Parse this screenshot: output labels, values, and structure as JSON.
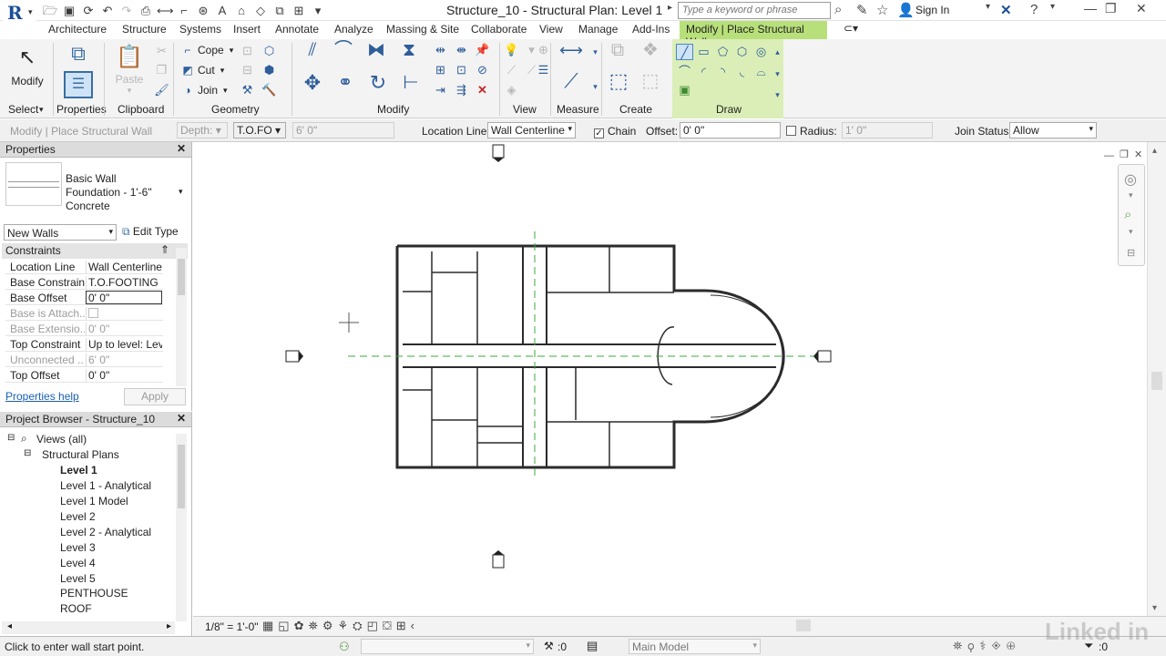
{
  "window": {
    "title": "Structure_10 - Structural Plan: Level 1",
    "search_placeholder": "Type a keyword or phrase",
    "signin": "Sign In"
  },
  "tabs": [
    "Architecture",
    "Structure",
    "Systems",
    "Insert",
    "Annotate",
    "Analyze",
    "Massing & Site",
    "Collaborate",
    "View",
    "Manage",
    "Add-Ins"
  ],
  "context_tab": "Modify | Place Structural Wall",
  "ribbon": {
    "modify": "Modify",
    "properties": "Properties",
    "paste": "Paste",
    "cope": "Cope",
    "cut": "Cut",
    "join": "Join",
    "panels": {
      "select": "Select",
      "properties": "Properties",
      "clipboard": "Clipboard",
      "geometry": "Geometry",
      "modify": "Modify",
      "view": "View",
      "measure": "Measure",
      "create": "Create",
      "draw": "Draw"
    }
  },
  "options": {
    "context": "Modify | Place Structural Wall",
    "depth_label": "Depth:",
    "depth_level": "T.O.FO",
    "depth_value": "6'  0\"",
    "location_line_label": "Location Line:",
    "location_line": "Wall Centerline",
    "chain_label": "Chain",
    "offset_label": "Offset:",
    "offset_value": "0'  0\"",
    "radius_label": "Radius:",
    "radius_value": "1'  0\"",
    "join_status_label": "Join Status:",
    "join_status": "Allow"
  },
  "properties": {
    "title": "Properties",
    "type_line1": "Basic Wall",
    "type_line2": "Foundation - 1'-6\"",
    "type_line3": "Concrete",
    "filter": "New Walls",
    "edit_type": "Edit Type",
    "section": "Constraints",
    "rows": [
      {
        "k": "Location Line",
        "v": "Wall Centerline"
      },
      {
        "k": "Base Constraint",
        "v": "T.O.FOOTING"
      },
      {
        "k": "Base Offset",
        "v": "0'  0\""
      },
      {
        "k": "Base is Attach...",
        "v": ""
      },
      {
        "k": "Base Extensio...",
        "v": "0'  0\""
      },
      {
        "k": "Top Constraint",
        "v": "Up to level: Lev..."
      },
      {
        "k": "Unconnected ...",
        "v": "6'  0\""
      },
      {
        "k": "Top Offset",
        "v": "0'  0\""
      }
    ],
    "help": "Properties help",
    "apply": "Apply"
  },
  "browser": {
    "title": "Project Browser - Structure_10",
    "root": "Views (all)",
    "group": "Structural Plans",
    "items": [
      "Level 1",
      "Level 1 - Analytical",
      "Level 1 Model",
      "Level 2",
      "Level 2 - Analytical",
      "Level 3",
      "Level 4",
      "Level 5",
      "PENTHOUSE",
      "ROOF"
    ]
  },
  "viewbar": {
    "scale": "1/8\" = 1'-0\""
  },
  "status": {
    "message": "Click to enter wall start point.",
    "worksets": ":0",
    "model": "Main Model",
    "filter_count": ":0"
  },
  "watermark": "Linked in"
}
